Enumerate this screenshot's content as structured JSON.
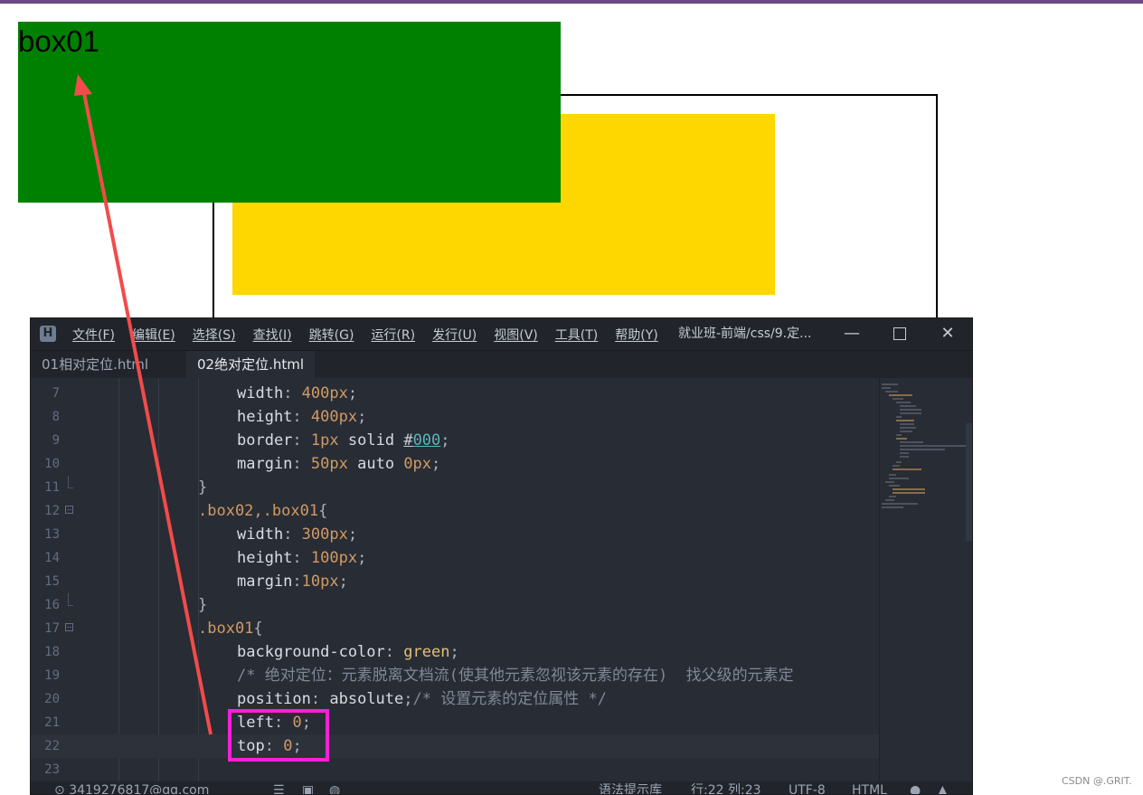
{
  "page": {
    "box01_label": "box01",
    "colors": {
      "green_box": "#008000",
      "yellow_box": "#ffd700",
      "border": "#000000"
    }
  },
  "editor": {
    "menu": [
      "文件(F)",
      "编辑(E)",
      "选择(S)",
      "查找(I)",
      "跳转(G)",
      "运行(R)",
      "发行(U)",
      "视图(V)",
      "工具(T)",
      "帮助(Y)"
    ],
    "title": "就业班-前端/css/9.定...",
    "tabs": [
      "01相对定位.html",
      "02绝对定位.html"
    ],
    "active_tab_index": 1,
    "lines": [
      {
        "n": "7"
      },
      {
        "n": "8"
      },
      {
        "n": "9"
      },
      {
        "n": "10"
      },
      {
        "n": "11"
      },
      {
        "n": "12"
      },
      {
        "n": "13"
      },
      {
        "n": "14"
      },
      {
        "n": "15"
      },
      {
        "n": "16"
      },
      {
        "n": "17"
      },
      {
        "n": "18"
      },
      {
        "n": "19"
      },
      {
        "n": "20"
      },
      {
        "n": "21"
      },
      {
        "n": "22"
      },
      {
        "n": "23"
      }
    ],
    "code": {
      "l7": {
        "prop": "width",
        "val": "400px"
      },
      "l8": {
        "prop": "height",
        "val": "400px"
      },
      "l9": {
        "prop": "border",
        "num": "1px",
        "kw": "solid",
        "hash": "#",
        "hex": "000"
      },
      "l10": {
        "prop": "margin",
        "num1": "50px",
        "kw": "auto",
        "num2": "0px"
      },
      "l11": "}",
      "l12": {
        "sel": ".box02,.box01",
        "brace": "{"
      },
      "l13": {
        "prop": "width",
        "val": "300px"
      },
      "l14": {
        "prop": "height",
        "val": "100px"
      },
      "l15": {
        "prop": "margin",
        "val": "10px"
      },
      "l16": "}",
      "l17": {
        "sel": ".box01",
        "brace": "{"
      },
      "l18": {
        "prop": "background-color",
        "val": "green"
      },
      "l19": "/* 绝对定位：元素脱离文档流(使其他元素忽视该元素的存在)  找父级的元素定",
      "l20": {
        "prop": "position",
        "val": "absolute",
        "comment": "/* 设置元素的定位属性 */"
      },
      "l21": {
        "prop": "left",
        "val": "0"
      },
      "l22": {
        "prop": "top",
        "val": "0"
      }
    },
    "status": {
      "user": "3419276817@qq.com",
      "hint": "语法提示库",
      "position": "行:22  列:23",
      "encoding": "UTF-8",
      "language": "HTML"
    }
  },
  "watermark": "CSDN @.GRIT."
}
